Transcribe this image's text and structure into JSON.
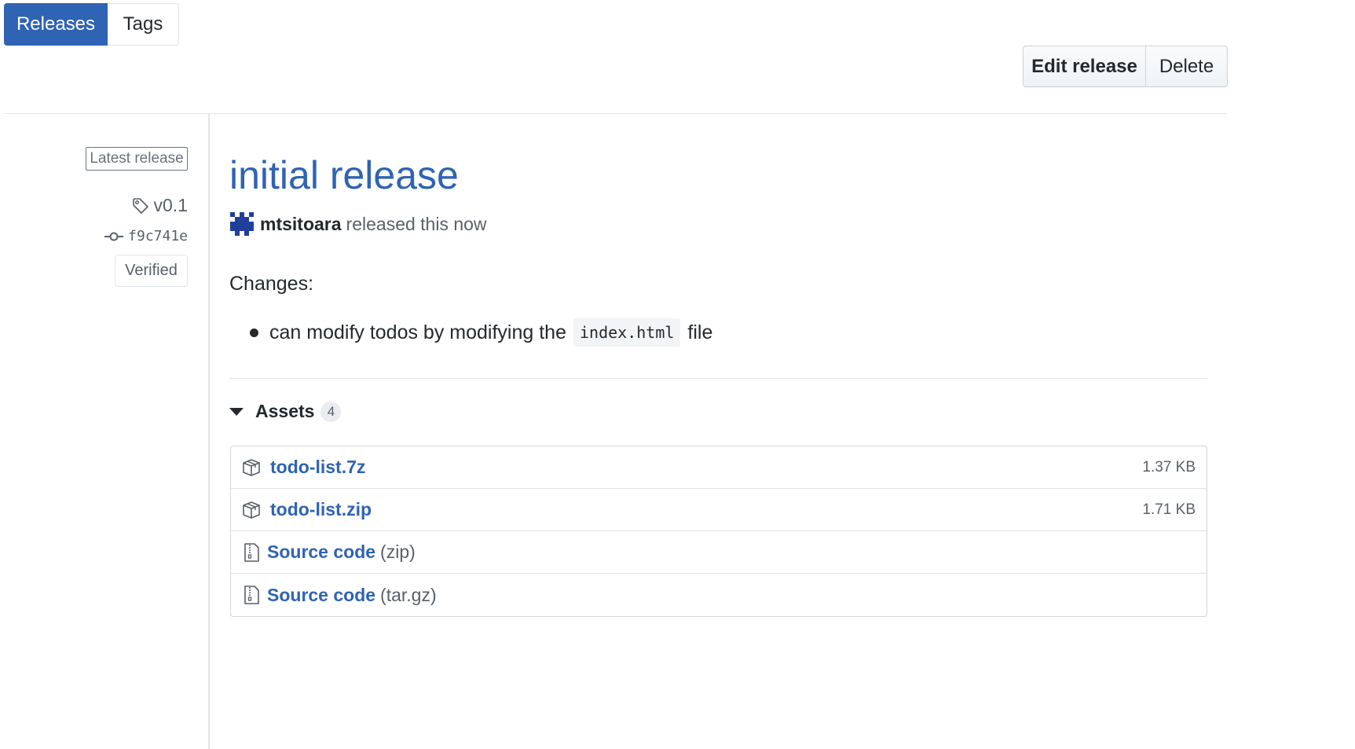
{
  "tabs": [
    {
      "label": "Releases",
      "active": true
    },
    {
      "label": "Tags",
      "active": false
    }
  ],
  "actions": {
    "edit_label": "Edit release",
    "delete_label": "Delete"
  },
  "meta": {
    "latest_badge": "Latest release",
    "tag": "v0.1",
    "commit": "f9c741e",
    "verified": "Verified"
  },
  "release": {
    "title": "initial release",
    "author": "mtsitoara",
    "released_text": "released this now",
    "changes_heading": "Changes:",
    "bullet_pre": "can modify todos by modifying the",
    "bullet_code": "index.html",
    "bullet_post": "file"
  },
  "assets": {
    "label": "Assets",
    "count": "4",
    "items": [
      {
        "name": "todo-list.7z",
        "suffix": "",
        "size": "1.37 KB",
        "icon": "package-icon"
      },
      {
        "name": "todo-list.zip",
        "suffix": "",
        "size": "1.71 KB",
        "icon": "package-icon"
      },
      {
        "name": "Source code",
        "suffix": "(zip)",
        "size": "",
        "icon": "file-zip-icon"
      },
      {
        "name": "Source code",
        "suffix": "(tar.gz)",
        "size": "",
        "icon": "file-zip-icon"
      }
    ]
  },
  "colors": {
    "accent": "#2f63b3",
    "text": "#24292e",
    "muted": "#586069",
    "border": "#e1e4e8"
  }
}
